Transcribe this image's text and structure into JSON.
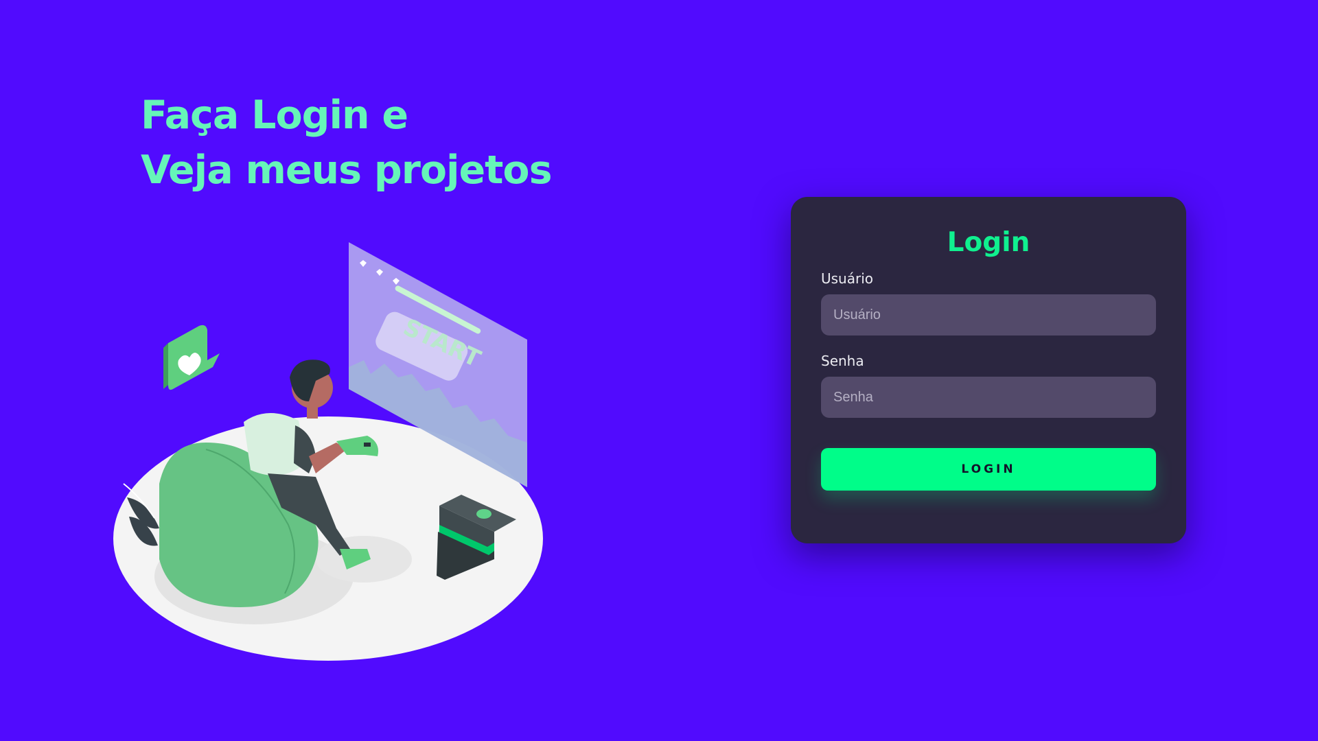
{
  "hero": {
    "line1": "Faça Login e",
    "line2": "Veja meus projetos"
  },
  "illustration": {
    "screen_text": "START"
  },
  "login_form": {
    "title": "Login",
    "username_label": "Usuário",
    "username_placeholder": "Usuário",
    "password_label": "Senha",
    "password_placeholder": "Senha",
    "submit_label": "LOGIN"
  },
  "colors": {
    "background": "#510bfe",
    "accent": "#66f5b8",
    "card": "#2b2640",
    "input": "#534a6a",
    "button": "#00fd89"
  }
}
